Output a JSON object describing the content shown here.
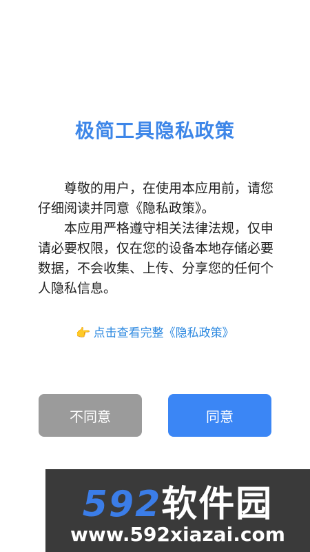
{
  "dialog": {
    "title": "极简工具隐私政策",
    "paragraph_1": "尊敬的用户，在使用本应用前，请您仔细阅读并同意《隐私政策》。",
    "paragraph_2": "本应用严格遵守相关法律法规，仅申请必要权限，仅在您的设备本地存储必要数据，不会收集、上传、分享您的任何个人隐私信息。",
    "link_icon": "👉",
    "link_text": "点击查看完整《隐私政策》",
    "disagree_label": "不同意",
    "agree_label": "同意"
  },
  "watermark": {
    "logo_number": "592",
    "logo_text": "软件园",
    "url": "www.592xiazai.com"
  },
  "colors": {
    "title": "#3d86e8",
    "link": "#2f8ae0",
    "disagree_button": "#9b9b9b",
    "agree_button": "#3b86f5"
  }
}
